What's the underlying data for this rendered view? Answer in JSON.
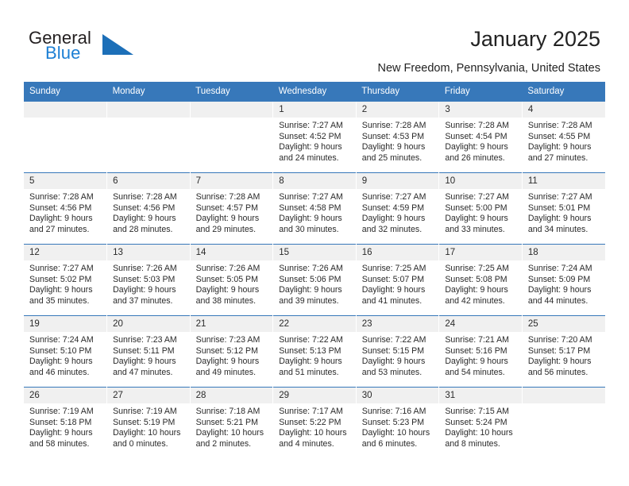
{
  "brand": {
    "name_part1": "General",
    "name_part2": "Blue",
    "triangle_color": "#1c6fb8",
    "accent_color": "#1c7fd4"
  },
  "header": {
    "title": "January 2025",
    "location": "New Freedom, Pennsylvania, United States"
  },
  "theme": {
    "header_bg": "#3778ba",
    "daynum_bg": "#f0f0f0",
    "text": "#2a2a2a"
  },
  "weekday_headers": [
    "Sunday",
    "Monday",
    "Tuesday",
    "Wednesday",
    "Thursday",
    "Friday",
    "Saturday"
  ],
  "labels": {
    "sunrise_prefix": "Sunrise:",
    "sunset_prefix": "Sunset:",
    "daylight_prefix": "Daylight:"
  },
  "weeks": [
    [
      {
        "day": "",
        "empty": true
      },
      {
        "day": "",
        "empty": true
      },
      {
        "day": "",
        "empty": true
      },
      {
        "day": "1",
        "sunrise": "Sunrise: 7:27 AM",
        "sunset": "Sunset: 4:52 PM",
        "daylight_line1": "Daylight: 9 hours",
        "daylight_line2": "and 24 minutes."
      },
      {
        "day": "2",
        "sunrise": "Sunrise: 7:28 AM",
        "sunset": "Sunset: 4:53 PM",
        "daylight_line1": "Daylight: 9 hours",
        "daylight_line2": "and 25 minutes."
      },
      {
        "day": "3",
        "sunrise": "Sunrise: 7:28 AM",
        "sunset": "Sunset: 4:54 PM",
        "daylight_line1": "Daylight: 9 hours",
        "daylight_line2": "and 26 minutes."
      },
      {
        "day": "4",
        "sunrise": "Sunrise: 7:28 AM",
        "sunset": "Sunset: 4:55 PM",
        "daylight_line1": "Daylight: 9 hours",
        "daylight_line2": "and 27 minutes."
      }
    ],
    [
      {
        "day": "5",
        "sunrise": "Sunrise: 7:28 AM",
        "sunset": "Sunset: 4:56 PM",
        "daylight_line1": "Daylight: 9 hours",
        "daylight_line2": "and 27 minutes."
      },
      {
        "day": "6",
        "sunrise": "Sunrise: 7:28 AM",
        "sunset": "Sunset: 4:56 PM",
        "daylight_line1": "Daylight: 9 hours",
        "daylight_line2": "and 28 minutes."
      },
      {
        "day": "7",
        "sunrise": "Sunrise: 7:28 AM",
        "sunset": "Sunset: 4:57 PM",
        "daylight_line1": "Daylight: 9 hours",
        "daylight_line2": "and 29 minutes."
      },
      {
        "day": "8",
        "sunrise": "Sunrise: 7:27 AM",
        "sunset": "Sunset: 4:58 PM",
        "daylight_line1": "Daylight: 9 hours",
        "daylight_line2": "and 30 minutes."
      },
      {
        "day": "9",
        "sunrise": "Sunrise: 7:27 AM",
        "sunset": "Sunset: 4:59 PM",
        "daylight_line1": "Daylight: 9 hours",
        "daylight_line2": "and 32 minutes."
      },
      {
        "day": "10",
        "sunrise": "Sunrise: 7:27 AM",
        "sunset": "Sunset: 5:00 PM",
        "daylight_line1": "Daylight: 9 hours",
        "daylight_line2": "and 33 minutes."
      },
      {
        "day": "11",
        "sunrise": "Sunrise: 7:27 AM",
        "sunset": "Sunset: 5:01 PM",
        "daylight_line1": "Daylight: 9 hours",
        "daylight_line2": "and 34 minutes."
      }
    ],
    [
      {
        "day": "12",
        "sunrise": "Sunrise: 7:27 AM",
        "sunset": "Sunset: 5:02 PM",
        "daylight_line1": "Daylight: 9 hours",
        "daylight_line2": "and 35 minutes."
      },
      {
        "day": "13",
        "sunrise": "Sunrise: 7:26 AM",
        "sunset": "Sunset: 5:03 PM",
        "daylight_line1": "Daylight: 9 hours",
        "daylight_line2": "and 37 minutes."
      },
      {
        "day": "14",
        "sunrise": "Sunrise: 7:26 AM",
        "sunset": "Sunset: 5:05 PM",
        "daylight_line1": "Daylight: 9 hours",
        "daylight_line2": "and 38 minutes."
      },
      {
        "day": "15",
        "sunrise": "Sunrise: 7:26 AM",
        "sunset": "Sunset: 5:06 PM",
        "daylight_line1": "Daylight: 9 hours",
        "daylight_line2": "and 39 minutes."
      },
      {
        "day": "16",
        "sunrise": "Sunrise: 7:25 AM",
        "sunset": "Sunset: 5:07 PM",
        "daylight_line1": "Daylight: 9 hours",
        "daylight_line2": "and 41 minutes."
      },
      {
        "day": "17",
        "sunrise": "Sunrise: 7:25 AM",
        "sunset": "Sunset: 5:08 PM",
        "daylight_line1": "Daylight: 9 hours",
        "daylight_line2": "and 42 minutes."
      },
      {
        "day": "18",
        "sunrise": "Sunrise: 7:24 AM",
        "sunset": "Sunset: 5:09 PM",
        "daylight_line1": "Daylight: 9 hours",
        "daylight_line2": "and 44 minutes."
      }
    ],
    [
      {
        "day": "19",
        "sunrise": "Sunrise: 7:24 AM",
        "sunset": "Sunset: 5:10 PM",
        "daylight_line1": "Daylight: 9 hours",
        "daylight_line2": "and 46 minutes."
      },
      {
        "day": "20",
        "sunrise": "Sunrise: 7:23 AM",
        "sunset": "Sunset: 5:11 PM",
        "daylight_line1": "Daylight: 9 hours",
        "daylight_line2": "and 47 minutes."
      },
      {
        "day": "21",
        "sunrise": "Sunrise: 7:23 AM",
        "sunset": "Sunset: 5:12 PM",
        "daylight_line1": "Daylight: 9 hours",
        "daylight_line2": "and 49 minutes."
      },
      {
        "day": "22",
        "sunrise": "Sunrise: 7:22 AM",
        "sunset": "Sunset: 5:13 PM",
        "daylight_line1": "Daylight: 9 hours",
        "daylight_line2": "and 51 minutes."
      },
      {
        "day": "23",
        "sunrise": "Sunrise: 7:22 AM",
        "sunset": "Sunset: 5:15 PM",
        "daylight_line1": "Daylight: 9 hours",
        "daylight_line2": "and 53 minutes."
      },
      {
        "day": "24",
        "sunrise": "Sunrise: 7:21 AM",
        "sunset": "Sunset: 5:16 PM",
        "daylight_line1": "Daylight: 9 hours",
        "daylight_line2": "and 54 minutes."
      },
      {
        "day": "25",
        "sunrise": "Sunrise: 7:20 AM",
        "sunset": "Sunset: 5:17 PM",
        "daylight_line1": "Daylight: 9 hours",
        "daylight_line2": "and 56 minutes."
      }
    ],
    [
      {
        "day": "26",
        "sunrise": "Sunrise: 7:19 AM",
        "sunset": "Sunset: 5:18 PM",
        "daylight_line1": "Daylight: 9 hours",
        "daylight_line2": "and 58 minutes."
      },
      {
        "day": "27",
        "sunrise": "Sunrise: 7:19 AM",
        "sunset": "Sunset: 5:19 PM",
        "daylight_line1": "Daylight: 10 hours",
        "daylight_line2": "and 0 minutes."
      },
      {
        "day": "28",
        "sunrise": "Sunrise: 7:18 AM",
        "sunset": "Sunset: 5:21 PM",
        "daylight_line1": "Daylight: 10 hours",
        "daylight_line2": "and 2 minutes."
      },
      {
        "day": "29",
        "sunrise": "Sunrise: 7:17 AM",
        "sunset": "Sunset: 5:22 PM",
        "daylight_line1": "Daylight: 10 hours",
        "daylight_line2": "and 4 minutes."
      },
      {
        "day": "30",
        "sunrise": "Sunrise: 7:16 AM",
        "sunset": "Sunset: 5:23 PM",
        "daylight_line1": "Daylight: 10 hours",
        "daylight_line2": "and 6 minutes."
      },
      {
        "day": "31",
        "sunrise": "Sunrise: 7:15 AM",
        "sunset": "Sunset: 5:24 PM",
        "daylight_line1": "Daylight: 10 hours",
        "daylight_line2": "and 8 minutes."
      },
      {
        "day": "",
        "empty": true
      }
    ]
  ]
}
